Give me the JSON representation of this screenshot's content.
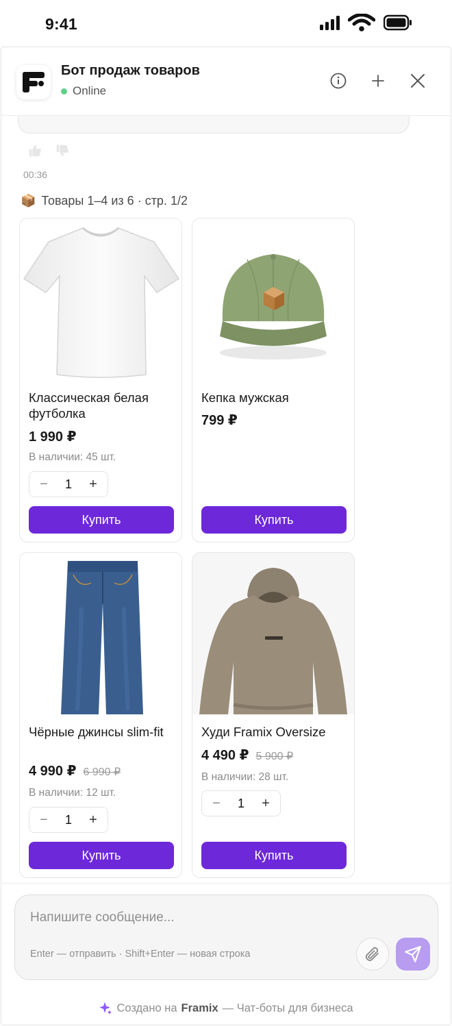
{
  "status_bar": {
    "time": "9:41"
  },
  "header": {
    "title": "Бот продаж товаров",
    "status": "Online"
  },
  "messages": {
    "time": "00:36",
    "caption_icon": "📦",
    "caption": "Товары 1–4 из 6 · стр. 1/2"
  },
  "products": [
    {
      "name": "Классическая белая футболка",
      "price": "1 990 ₽",
      "old_price": "",
      "stock": "В наличии: 45 шт.",
      "qty": "1",
      "buy_label": "Купить",
      "image": "white-tshirt"
    },
    {
      "name": "Кепка мужская",
      "price": "799 ₽",
      "old_price": "",
      "stock": "",
      "qty": "",
      "buy_label": "Купить",
      "image": "green-cap"
    },
    {
      "name": "Чёрные джинсы slim-fit",
      "price": "4 990 ₽",
      "old_price": "6 990 ₽",
      "stock": "В наличии: 12 шт.",
      "qty": "1",
      "buy_label": "Купить",
      "image": "blue-jeans"
    },
    {
      "name": "Худи Framix Oversize",
      "price": "4 490 ₽",
      "old_price": "5 900 ₽",
      "stock": "В наличии: 28 шт.",
      "qty": "1",
      "buy_label": "Купить",
      "image": "beige-hoodie"
    }
  ],
  "composer": {
    "placeholder": "Напишите сообщение...",
    "hint": "Enter — отправить · Shift+Enter — новая строка"
  },
  "footer": {
    "prefix": "Создано на",
    "brand": "Framix",
    "suffix": "— Чат-боты для бизнеса"
  },
  "colors": {
    "accent": "#6d28d9",
    "send_button": "#b79cf0",
    "online": "#5fd08a"
  }
}
